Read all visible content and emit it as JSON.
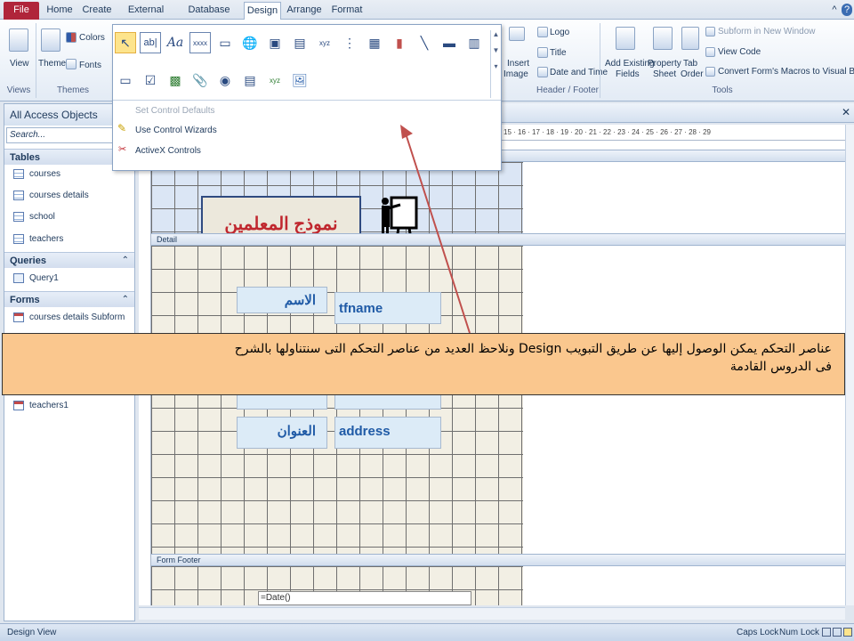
{
  "tabs": [
    "File",
    "Home",
    "Create",
    "External Data",
    "Database Tools",
    "Design",
    "Arrange",
    "Format"
  ],
  "ribbon": {
    "views_btn": "View",
    "views_group": "Views",
    "themes_btn": "Themes",
    "colors_btn": "Colors",
    "fonts_btn": "Fonts",
    "themes_group": "Themes",
    "logo_btn": "Logo",
    "title_btn": "Title",
    "datetime_btn": "Date and Time",
    "insert_image": "Insert",
    "insert_image2": "Image",
    "header_footer_group": "Header / Footer",
    "add_fields": "Add Existing",
    "add_fields2": "Fields",
    "property": "Property",
    "property2": "Sheet",
    "tab_order": "Tab",
    "tab_order2": "Order",
    "subform": "Subform in New Window",
    "view_code": "View Code",
    "convert_macros": "Convert Form's Macros to Visual Basic",
    "tools_group": "Tools"
  },
  "controls_popup": {
    "item_defaults": "Set Control Defaults",
    "item_wizards": "Use Control Wizards",
    "item_activex": "ActiveX Controls"
  },
  "nav": {
    "title": "All Access Objects",
    "search_placeholder": "Search...",
    "tables_header": "Tables",
    "tables": [
      "courses",
      "courses details",
      "school",
      "teachers"
    ],
    "queries_header": "Queries",
    "queries": [
      "Query1"
    ],
    "forms_header": "Forms",
    "forms": [
      "courses details Subform",
      "teachers1"
    ]
  },
  "ruler_text": "15 · 16 · 17 · 18 · 19 · 20 · 21 · 22 · 23 · 24 · 25 · 26 · 27 · 28 · 29",
  "form": {
    "header_title": "نموذج المعلمين",
    "detail_section": "Detail",
    "footer_section": "Form Footer",
    "label_name": "الاسم",
    "field_name": "tfname",
    "label_address": "العنوان",
    "field_address": "address",
    "footer_expr": "=Date()"
  },
  "callout": {
    "line1": "عناصر التحكم يمكن الوصول إليها عن طريق التبويب Design ونلاحظ العديد من عناصر التحكم التى سنتناولها بالشرح",
    "line2": "فى الدروس القادمة"
  },
  "status": {
    "mode": "Design View",
    "caps": "Caps Lock",
    "num": "Num Lock"
  },
  "colors": {
    "file_tab": "#b0253a",
    "callout_bg": "#fac78e",
    "arrow": "#c0504d",
    "title_text": "#c0282f",
    "label_text": "#1f5aa6"
  }
}
